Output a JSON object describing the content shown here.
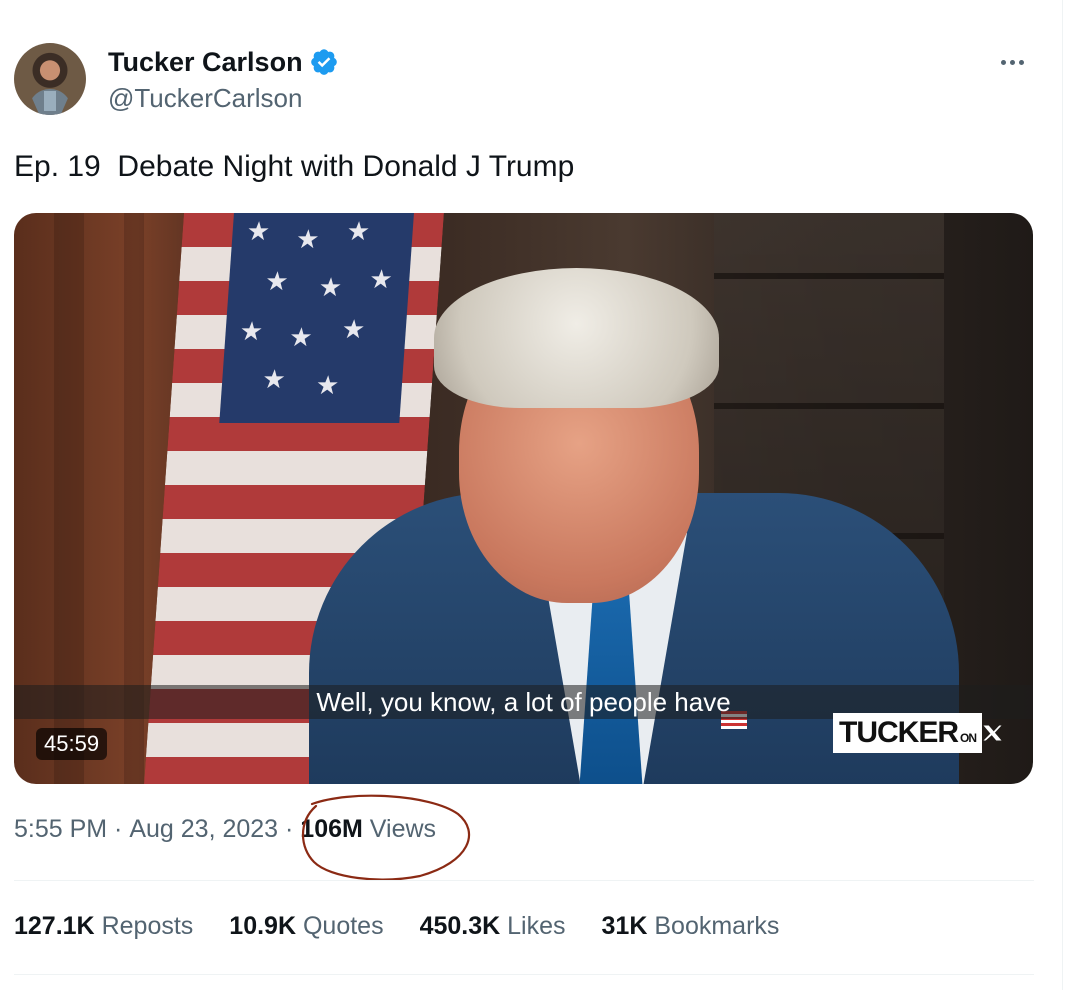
{
  "author": {
    "name": "Tucker Carlson",
    "handle": "@TuckerCarlson",
    "verified_color": "#1d9bf0"
  },
  "icons": [
    "verified-badge-icon",
    "more-options-icon",
    "x-logo-icon"
  ],
  "tweet": {
    "text": "Ep. 19  Debate Night with Donald J Trump"
  },
  "video": {
    "subtitle": "Well, you know, a lot of people have",
    "duration": "45:59",
    "watermark_text": "TUCKER",
    "watermark_on": "ON"
  },
  "meta": {
    "time": "5:55 PM",
    "separator": " · ",
    "date": "Aug 23, 2023",
    "views_count": "106M",
    "views_label": " Views"
  },
  "stats": [
    {
      "count": "127.1K",
      "label": "Reposts"
    },
    {
      "count": "10.9K",
      "label": "Quotes"
    },
    {
      "count": "450.3K",
      "label": "Likes"
    },
    {
      "count": "31K",
      "label": "Bookmarks"
    }
  ],
  "colors": {
    "text_primary": "#0f1419",
    "text_secondary": "#536471",
    "annotation": "#8b2a14"
  }
}
